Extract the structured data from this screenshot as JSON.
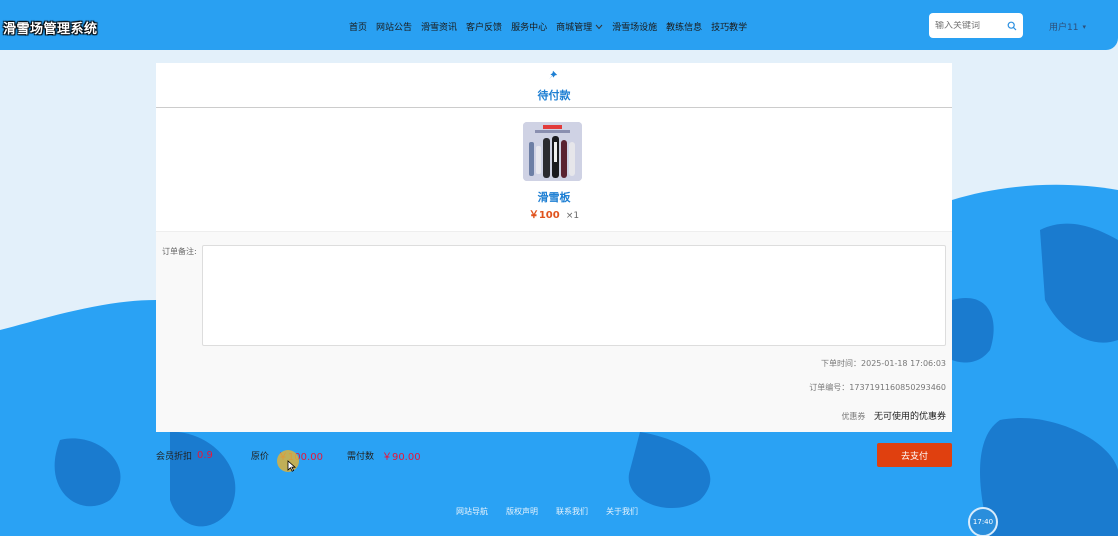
{
  "header": {
    "site_title": "滑雪场管理系统",
    "nav": [
      {
        "label": "首页"
      },
      {
        "label": "网站公告"
      },
      {
        "label": "滑雪资讯"
      },
      {
        "label": "客户反馈"
      },
      {
        "label": "服务中心"
      },
      {
        "label": "商城管理",
        "has_dropdown": true
      },
      {
        "label": "滑雪场设施"
      },
      {
        "label": "教练信息"
      },
      {
        "label": "技巧教学"
      }
    ],
    "search_placeholder": "输入关键词",
    "user_label": "用户11"
  },
  "order": {
    "status_title": "待付款",
    "product_name": "滑雪板",
    "price": "￥100",
    "quantity": "×1",
    "remark_label": "订单备注:",
    "remark_value": "",
    "order_time": "下单时间：2025-01-18 17:06:03",
    "order_number": "订单编号：1737191160850293460",
    "coupon_label": "优惠券",
    "coupon_value": "无可使用的优惠券"
  },
  "summary": {
    "discount_label": "会员折扣",
    "discount_value": "0.9",
    "original_label": "原价",
    "original_value": "￥100.00",
    "payable_label": "需付数",
    "payable_value": "￥90.00",
    "pay_button": "去支付"
  },
  "footer": {
    "links": [
      "网站导航",
      "版权声明",
      "联系我们",
      "关于我们"
    ],
    "clock": "17:40"
  },
  "colors": {
    "header_bg": "#29a0f2",
    "accent_blue": "#1e7fd3",
    "price_orange": "#e0531d",
    "pay_button": "#e0400f",
    "discount_red": "#e8153a"
  }
}
